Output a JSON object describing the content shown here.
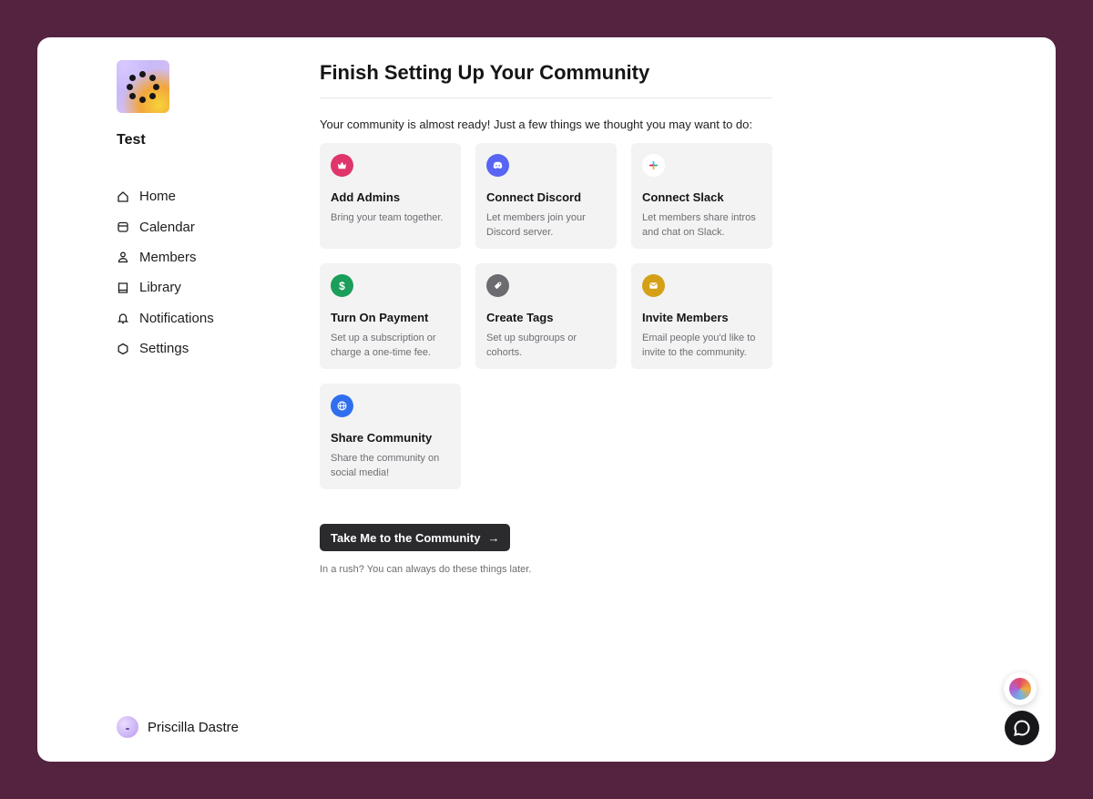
{
  "community": {
    "name": "Test"
  },
  "sidebar": {
    "items": [
      {
        "label": "Home",
        "icon": "home-icon"
      },
      {
        "label": "Calendar",
        "icon": "calendar-icon"
      },
      {
        "label": "Members",
        "icon": "members-icon"
      },
      {
        "label": "Library",
        "icon": "library-icon"
      },
      {
        "label": "Notifications",
        "icon": "bell-icon"
      },
      {
        "label": "Settings",
        "icon": "gear-icon"
      }
    ]
  },
  "user": {
    "name": "Priscilla Dastre"
  },
  "main": {
    "title": "Finish Setting Up Your Community",
    "intro": "Your community is almost ready! Just a few things we thought you may want to do:",
    "cards": [
      {
        "title": "Add Admins",
        "description": "Bring your team together.",
        "icon": "crown-icon",
        "color": "#e0356a"
      },
      {
        "title": "Connect Discord",
        "description": "Let members join your Discord server.",
        "icon": "discord-icon",
        "color": "#5865f2"
      },
      {
        "title": "Connect Slack",
        "description": "Let members share intros and chat on Slack.",
        "icon": "slack-icon",
        "color": "#ffffff"
      },
      {
        "title": "Turn On Payment",
        "description": "Set up a subscription or charge a one-time fee.",
        "icon": "dollar-icon",
        "color": "#1a9e5a"
      },
      {
        "title": "Create Tags",
        "description": "Set up subgroups or cohorts.",
        "icon": "tag-icon",
        "color": "#6b6b70"
      },
      {
        "title": "Invite Members",
        "description": "Email people you'd like to invite to the community.",
        "icon": "mail-icon",
        "color": "#d4a017"
      },
      {
        "title": "Share Community",
        "description": "Share the community on social media!",
        "icon": "globe-icon",
        "color": "#2f6fed"
      }
    ],
    "cta_label": "Take Me to the Community",
    "note": "In a rush? You can always do these things later."
  },
  "colors": {
    "page_background": "#542340",
    "cta_background": "#2b2b2e",
    "card_background": "#f3f3f4"
  }
}
